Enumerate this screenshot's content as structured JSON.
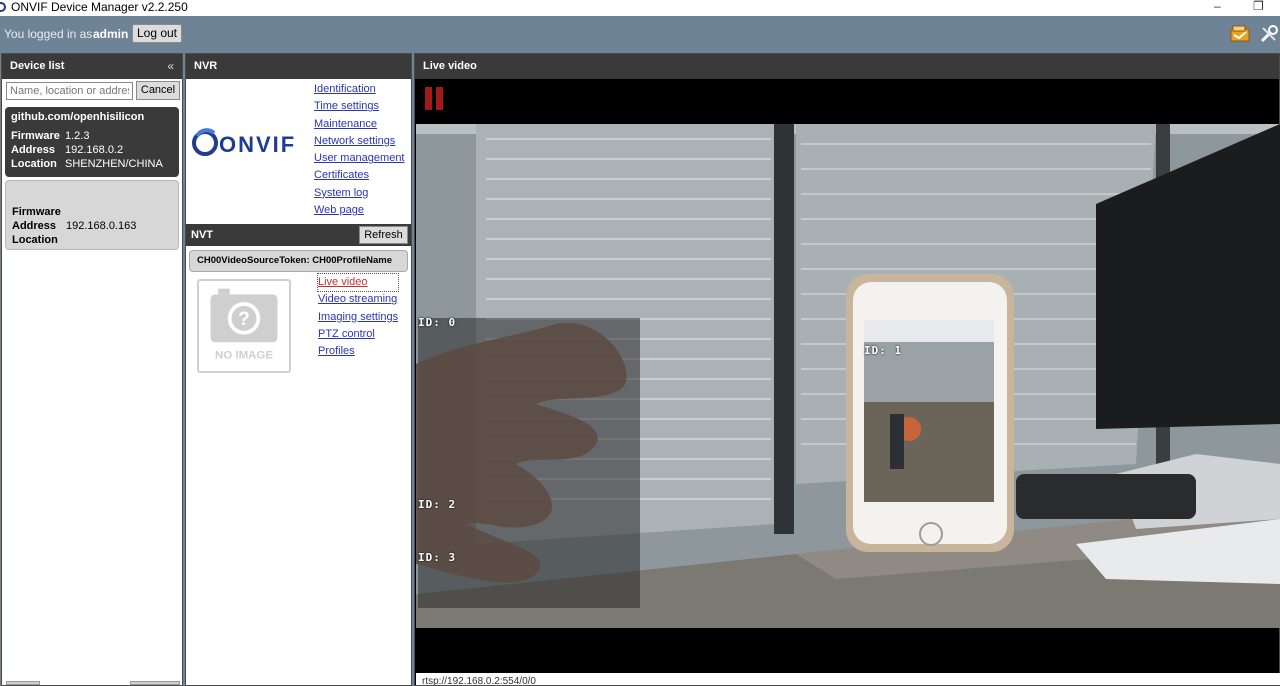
{
  "window": {
    "title": "ONVIF Device Manager v2.2.250",
    "minimize_glyph": "–",
    "restore_glyph": "❐"
  },
  "topbar": {
    "logged_in_text": "You logged in as",
    "username": "admin",
    "logout_label": "Log out"
  },
  "device_list": {
    "title": "Device list",
    "collapse_glyph": "«",
    "search_placeholder": "Name, location or address",
    "cancel_label": "Cancel",
    "devices": [
      {
        "name": "github.com/openhisilicon",
        "firmware_label": "Firmware",
        "firmware": "1.2.3",
        "address_label": "Address",
        "address": "192.168.0.2",
        "location_label": "Location",
        "location": "SHENZHEN/CHINA"
      },
      {
        "name": "",
        "firmware_label": "Firmware",
        "firmware": "",
        "address_label": "Address",
        "address": "192.168.0.163",
        "location_label": "Location",
        "location": ""
      }
    ]
  },
  "nvr": {
    "title": "NVR",
    "logo_text": "ONVIF",
    "menu": [
      "Identification",
      "Time settings",
      "Maintenance",
      "Network settings",
      "User management",
      "Certificates",
      "System log",
      "Web page"
    ]
  },
  "nvt": {
    "title": "NVT",
    "refresh_label": "Refresh",
    "profile": "CH00VideoSourceToken: CH00ProfileName",
    "no_image_text": "NO IMAGE",
    "menu": [
      "Live video",
      "Video streaming",
      "Imaging settings",
      "PTZ control",
      "Profiles"
    ]
  },
  "live_video": {
    "title": "Live video",
    "osd_labels": [
      "ID: 0",
      "ID: 1",
      "ID: 2",
      "ID: 3"
    ],
    "stream_url": "rtsp://192.168.0.2:554/0/0"
  },
  "colors": {
    "panel_header": "#3a3a3a",
    "link": "#2a35b8",
    "active_link": "#c83030",
    "pause_red": "#a01a1a",
    "app_background": "#6f8396"
  }
}
